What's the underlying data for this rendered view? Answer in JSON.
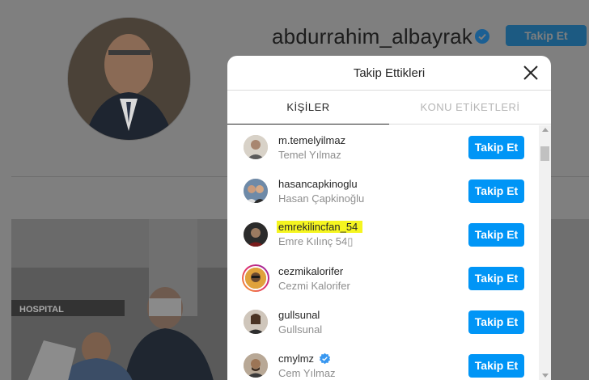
{
  "profile": {
    "username": "abdurrahim_albayrak",
    "follow_label": "Takip Et"
  },
  "post": {
    "sign_text": "HOSPITAL"
  },
  "modal": {
    "title": "Takip Ettikleri",
    "tabs": [
      {
        "label": "KİŞİLER",
        "active": true
      },
      {
        "label": "KONU ETİKETLERİ",
        "active": false
      }
    ],
    "follow_label": "Takip Et",
    "accounts": [
      {
        "username": "m.temelyilmaz",
        "name": "Temel Yılmaz",
        "verified": false,
        "highlighted": false,
        "story": false
      },
      {
        "username": "hasancapkinoglu",
        "name": "Hasan Çapkinoğlu",
        "verified": false,
        "highlighted": false,
        "story": false
      },
      {
        "username": "emrekilincfan_54",
        "name": "Emre Kılınç 54▯",
        "verified": false,
        "highlighted": true,
        "story": false
      },
      {
        "username": "cezmikalorifer",
        "name": "Cezmi Kalorifer",
        "verified": false,
        "highlighted": false,
        "story": true
      },
      {
        "username": "gullsunal",
        "name": "Gullsunal",
        "verified": false,
        "highlighted": false,
        "story": false
      },
      {
        "username": "cmylmz",
        "name": "Cem Yılmaz",
        "verified": true,
        "highlighted": false,
        "story": false
      }
    ]
  },
  "colors": {
    "accent": "#0095f6",
    "highlight": "#f5f520",
    "verified": "#3897f0"
  }
}
